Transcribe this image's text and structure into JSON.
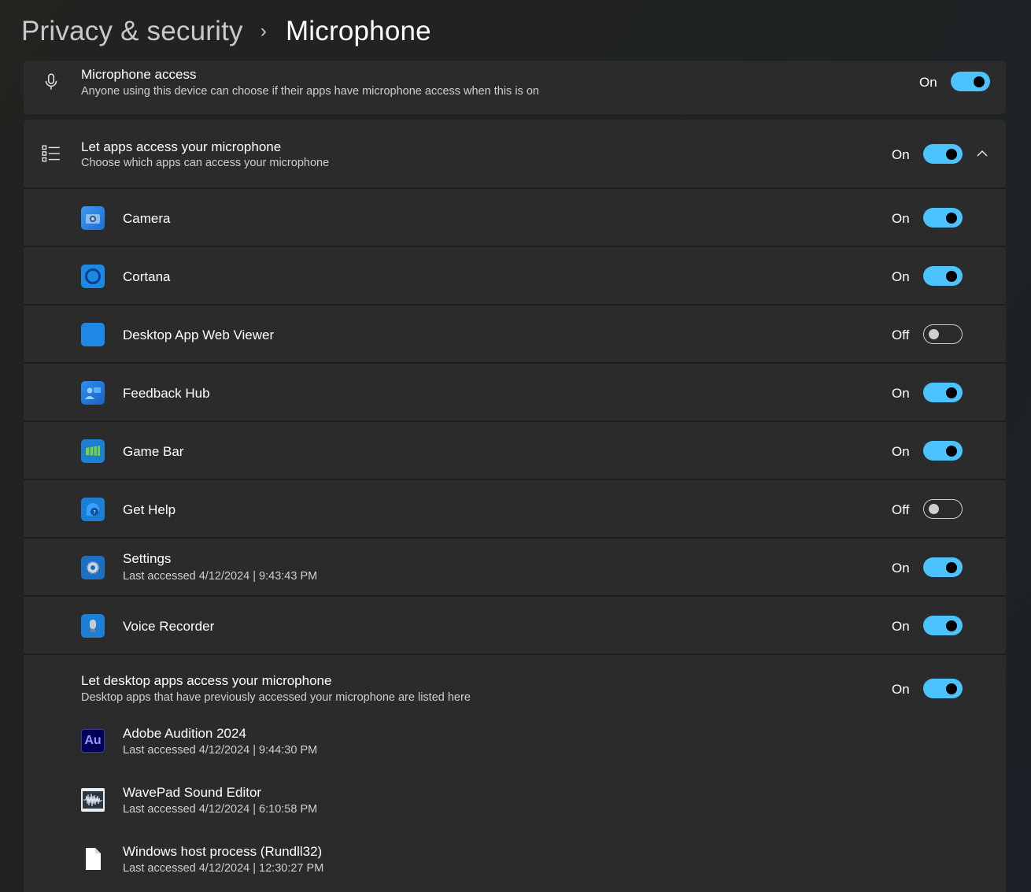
{
  "breadcrumb": {
    "parent": "Privacy & security",
    "separator": "›",
    "current": "Microphone"
  },
  "mic_access": {
    "title": "Microphone access",
    "description": "Anyone using this device can choose if their apps have microphone access when this is on",
    "state": "On",
    "icon": "microphone-icon"
  },
  "apps_access": {
    "title": "Let apps access your microphone",
    "description": "Choose which apps can access your microphone",
    "state": "On",
    "icon": "list-icon",
    "expanded": true
  },
  "apps": [
    {
      "name": "Camera",
      "state": "On",
      "icon": "camera-icon",
      "last_accessed": ""
    },
    {
      "name": "Cortana",
      "state": "On",
      "icon": "cortana-icon",
      "last_accessed": ""
    },
    {
      "name": "Desktop App Web Viewer",
      "state": "Off",
      "icon": "web-viewer-icon",
      "last_accessed": ""
    },
    {
      "name": "Feedback Hub",
      "state": "On",
      "icon": "feedback-hub-icon",
      "last_accessed": ""
    },
    {
      "name": "Game Bar",
      "state": "On",
      "icon": "game-bar-icon",
      "last_accessed": ""
    },
    {
      "name": "Get Help",
      "state": "Off",
      "icon": "get-help-icon",
      "last_accessed": ""
    },
    {
      "name": "Settings",
      "state": "On",
      "icon": "settings-gear-icon",
      "last_accessed": "Last accessed 4/12/2024  |  9:43:43 PM"
    },
    {
      "name": "Voice Recorder",
      "state": "On",
      "icon": "voice-recorder-icon",
      "last_accessed": ""
    }
  ],
  "desktop_access": {
    "title": "Let desktop apps access your microphone",
    "description": "Desktop apps that have previously accessed your microphone are listed here",
    "state": "On"
  },
  "desktop_apps": [
    {
      "name": "Adobe Audition 2024",
      "last_accessed": "Last accessed 4/12/2024  |  9:44:30 PM",
      "icon": "adobe-audition-icon",
      "icon_text": "Au"
    },
    {
      "name": "WavePad Sound Editor",
      "last_accessed": "Last accessed 4/12/2024  |  6:10:58 PM",
      "icon": "wavepad-icon"
    },
    {
      "name": "Windows host process (Rundll32)",
      "last_accessed": "Last accessed 4/12/2024  |  12:30:27 PM",
      "icon": "blank-file-icon"
    }
  ],
  "colors": {
    "accent": "#4cc2ff",
    "card": "#2b2b2b",
    "text_secondary": "#cfcfcf"
  }
}
